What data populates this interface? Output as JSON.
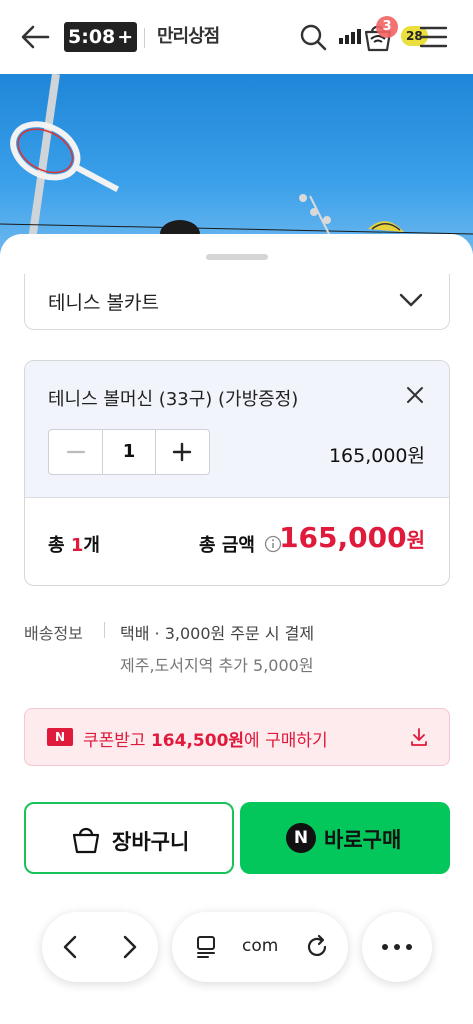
{
  "status": {
    "time": "5:08",
    "time_extra": "+",
    "battery": "28",
    "cart_badge": "3"
  },
  "header": {
    "logo": "만리상점"
  },
  "sheet": {
    "select": {
      "label": "테니스 볼카트"
    },
    "option": {
      "name": "테니스 볼머신 (33구) (가방증정)",
      "quantity": "1",
      "price": "165,000원"
    },
    "total": {
      "count_prefix": "총 ",
      "count_value": "1",
      "count_suffix": "개",
      "amount_label": "총 금액",
      "amount_value": "165,000",
      "amount_unit": "원"
    },
    "shipping": {
      "label": "배송정보",
      "main": "택배 · 3,000원 주문 시 결제",
      "extra": "제주,도서지역 추가 5,000원"
    },
    "coupon": {
      "logo": "N",
      "prefix": "쿠폰받고 ",
      "amount": "164,500원",
      "suffix": "에 구매하기"
    },
    "buttons": {
      "cart": "장바구니",
      "buy_icon": "N",
      "buy": "바로구매"
    }
  },
  "browser": {
    "url": "com"
  },
  "colors": {
    "accent_red": "#e01a3b",
    "naver_green": "#03c75a"
  }
}
